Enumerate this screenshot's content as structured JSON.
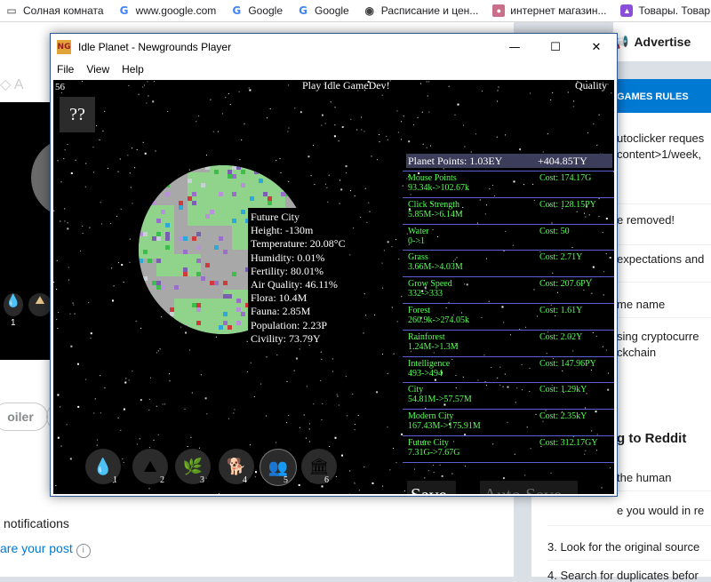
{
  "bookmarks": {
    "items": [
      {
        "label": "Солная комната",
        "icon": "bookmark-icon"
      },
      {
        "label": "www.google.com",
        "icon": "google-g-icon"
      },
      {
        "label": "Google",
        "icon": "google-g-icon"
      },
      {
        "label": "Google",
        "icon": "google-g-icon"
      },
      {
        "label": "Расписание и цен...",
        "icon": "globe-icon"
      },
      {
        "label": "интернет магазин...",
        "icon": "shop-avatar-icon"
      },
      {
        "label": "Товары. Товар",
        "icon": "purple-bag-icon"
      }
    ]
  },
  "reddit": {
    "advertise": "Advertise",
    "rules_title": "GAMES RULES",
    "rules": [
      "utoclicker reques",
      "content>1/week,",
      "e removed!",
      "expectations and",
      "me name",
      "sing cryptocurre",
      "ckchain"
    ],
    "howto": [
      "g to Reddit",
      "the human",
      "e you would in re",
      "3. Look for the original source",
      "4. Search for duplicates befor"
    ],
    "spoiler": "oiler",
    "notifications": "notifications",
    "share_post": "are your post"
  },
  "window": {
    "title": "Idle Planet - Newgrounds Player",
    "logo_text": "NG",
    "menu": [
      "File",
      "View",
      "Help"
    ],
    "controls": {
      "minimize": "—",
      "maximize": "☐",
      "close": "✕"
    }
  },
  "game": {
    "fps": "56",
    "play_link": "Play Idle GameDev!",
    "quality": "Quality",
    "help_label": "??",
    "planet_info": [
      "Future City",
      "Height: -130m",
      "Temperature: 20.08°C",
      "Humidity: 0.01%",
      "Fertility: 80.01%",
      "Air Quality: 46.11%",
      "Flora: 10.4M",
      "Fauna: 2.85M",
      "Population: 2.23P",
      "Civility: 73.79Y"
    ],
    "points_label": "Planet Points: 1.03EY",
    "points_rate": "+404.85TY",
    "upgrades": [
      {
        "name": "Mouse Points",
        "value": "93.34k->102.67k",
        "cost": "Cost: 174.17G"
      },
      {
        "name": "Click Strength",
        "value": "5.85M->6.14M",
        "cost": "Cost: 128.15PY"
      },
      {
        "name": "Water",
        "value": "0->1",
        "cost": "Cost: 50"
      },
      {
        "name": "Grass",
        "value": "3.66M->4.03M",
        "cost": "Cost: 2.71Y"
      },
      {
        "name": "Grow Speed",
        "value": "332->333",
        "cost": "Cost: 207.6PY"
      },
      {
        "name": "Forest",
        "value": "260.9k->274.05k",
        "cost": "Cost: 1.61Y"
      },
      {
        "name": "Rainforest",
        "value": "1.24M->1.3M",
        "cost": "Cost: 2.02Y"
      },
      {
        "name": "Intelligence",
        "value": "493->494",
        "cost": "Cost: 147.96PY"
      },
      {
        "name": "City",
        "value": "54.81M->57.57M",
        "cost": "Cost: 1.29kY"
      },
      {
        "name": "Modern City",
        "value": "167.43M->175.91M",
        "cost": "Cost: 2.35kY"
      },
      {
        "name": "Future City",
        "value": "7.31G->7.67G",
        "cost": "Cost: 312.17GY"
      }
    ],
    "tools": [
      {
        "num": "1",
        "icon": "water-drop-icon",
        "glyph": "💧"
      },
      {
        "num": "2",
        "icon": "sand-pile-icon",
        "glyph": "⛰"
      },
      {
        "num": "3",
        "icon": "plant-icon",
        "glyph": "🌿"
      },
      {
        "num": "4",
        "icon": "animal-icon",
        "glyph": "🐕"
      },
      {
        "num": "5",
        "icon": "people-icon",
        "glyph": "👥"
      },
      {
        "num": "6",
        "icon": "building-icon",
        "glyph": "🏛"
      }
    ],
    "save": "Save",
    "auto_save": "Auto Save"
  },
  "colors": {
    "planet_gray": "#a8a8a8",
    "planet_green": "#8fd48a",
    "upgrade_text": "#57ff57",
    "divider": "#5a5fd6",
    "reddit_blue": "#0079d3"
  }
}
